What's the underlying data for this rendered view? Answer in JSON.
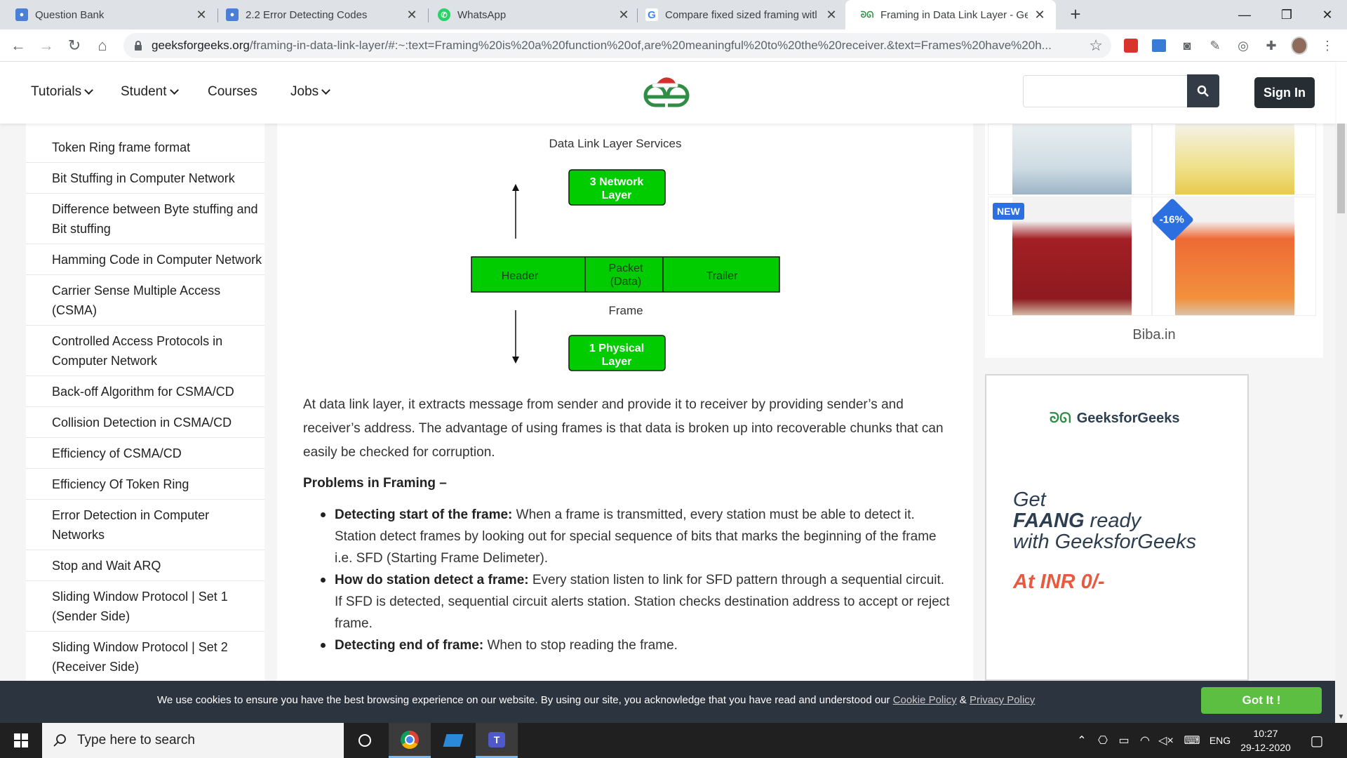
{
  "browser": {
    "tabs": [
      {
        "title": "Question Bank",
        "icon": "question-bank-icon",
        "icon_color": "#4a7fd6"
      },
      {
        "title": "2.2 Error Detecting Codes",
        "icon": "document-icon",
        "icon_color": "#4a7fd6"
      },
      {
        "title": "WhatsApp",
        "icon": "whatsapp-icon",
        "icon_color": "#25d366"
      },
      {
        "title": "Compare fixed sized framing witl",
        "icon": "google-icon",
        "icon_color": "#4285f4"
      },
      {
        "title": "Framing in Data Link Layer - Geel",
        "icon": "gfg-icon",
        "icon_color": "#2f8d46"
      }
    ],
    "new_tab": "+",
    "url_domain": "geeksforgeeks.org",
    "url_rest": "/framing-in-data-link-layer/#:~:text=Framing%20is%20a%20function%20of,are%20meaningful%20to%20the%20receiver.&text=Frames%20have%20h..."
  },
  "site": {
    "menu": [
      {
        "label": "Tutorials",
        "has_dropdown": true
      },
      {
        "label": "Student",
        "has_dropdown": true
      },
      {
        "label": "Courses",
        "has_dropdown": false
      },
      {
        "label": "Jobs",
        "has_dropdown": true
      }
    ],
    "signin": "Sign In",
    "brand_color": "#2f8d46"
  },
  "sidebar": {
    "items": [
      "Token Ring frame format",
      "Bit Stuffing in Computer Network",
      "Difference between Byte stuffing and Bit stuffing",
      "Hamming Code in Computer Network",
      "Carrier Sense Multiple Access (CSMA)",
      "Controlled Access Protocols in Computer Network",
      "Back-off Algorithm for CSMA/CD",
      "Collision Detection in CSMA/CD",
      "Efficiency of CSMA/CD",
      "Efficiency Of Token Ring",
      "Error Detection in Computer Networks",
      "Stop and Wait ARQ",
      "Sliding Window Protocol | Set 1 (Sender Side)",
      "Sliding Window Protocol | Set 2 (Receiver Side)"
    ]
  },
  "diagram": {
    "title": "Data Link Layer Services",
    "top_box": [
      "3 Network",
      "Layer"
    ],
    "frame_cells": [
      "Header",
      "Packet",
      "(Data)",
      "Trailer"
    ],
    "frame_label": "Frame",
    "bottom_box": [
      "1 Physical",
      "Layer"
    ],
    "box_color": "#00cc00"
  },
  "article": {
    "paragraph": "At data link layer, it extracts message from sender and provide it to receiver by providing sender’s and receiver’s address. The advantage of using frames is that data is broken up into recoverable chunks that can easily be checked for corruption.",
    "problems_heading": "Problems in Framing –",
    "problems": [
      {
        "bold": "Detecting start of the frame:",
        "text": " When a frame is transmitted, every station must be able to detect it. Station detect frames by looking out for special sequence of bits that marks the beginning of the frame i.e. SFD (Starting Frame Delimeter)."
      },
      {
        "bold": "How do station detect a frame:",
        "text": " Every station listen to link for SFD pattern through a sequential circuit. If SFD is detected, sequential circuit alerts station. Station checks destination address to accept or reject frame."
      },
      {
        "bold": "Detecting end of frame:",
        "text": " When to stop reading the frame."
      }
    ]
  },
  "ads": {
    "badge_new": "NEW",
    "badge_discount": "-16%",
    "store": "Biba.in",
    "gfg_brand": "GeeksforGeeks",
    "promo_get": "Get",
    "promo_faang": "FAANG",
    "promo_ready": " ready",
    "promo_with": "with GeeksforGeeks",
    "promo_price": "At INR 0/-"
  },
  "cookie": {
    "message": "We use cookies to ensure you have the best browsing experience on our website. By using our site, you acknowledge that you have read and understood our ",
    "cookie_policy": "Cookie Policy",
    "amp": " & ",
    "privacy_policy": "Privacy Policy",
    "button": "Got It !"
  },
  "taskbar": {
    "search_placeholder": "Type here to search",
    "language": "ENG",
    "time": "10:27",
    "date": "29-12-2020"
  }
}
